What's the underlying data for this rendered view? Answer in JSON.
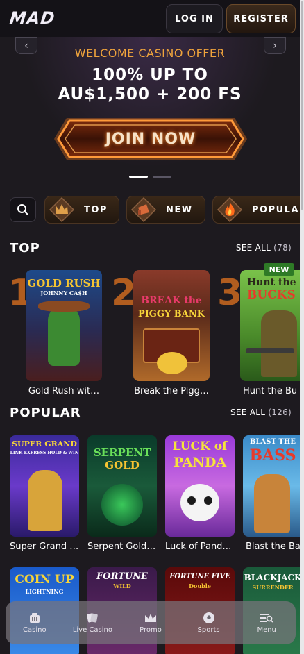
{
  "header": {
    "logo": "MAD",
    "login_label": "LOG IN",
    "register_label": "REGISTER"
  },
  "banner": {
    "offer": "WELCOME CASINO OFFER",
    "headline_line1": "100% UP TO",
    "headline_line2": "AU$1,500 + 200 FS",
    "cta_label": "JOIN NOW",
    "slide_count": 2,
    "active_slide": 1
  },
  "categories": [
    {
      "label": "TOP",
      "icon": "crown-icon"
    },
    {
      "label": "NEW",
      "icon": "megaphone-icon"
    },
    {
      "label": "POPULAR",
      "icon": "fire-icon"
    }
  ],
  "top": {
    "title": "TOP",
    "see_all_label": "SEE ALL",
    "count": "(78)",
    "items": [
      {
        "rank": "1",
        "title": "Gold Rush wit…",
        "art_line1": "GOLD RUSH",
        "art_line2": "JOHNNY CA$H"
      },
      {
        "rank": "2",
        "title": "Break the Pigg…",
        "art_line1": "BREAK the",
        "art_line2": "PIGGY BANK"
      },
      {
        "rank": "3",
        "title": "Hunt the Bu",
        "art_line1": "Hunt the",
        "art_line2": "BUCKS",
        "badge": "NEW"
      }
    ]
  },
  "popular": {
    "title": "POPULAR",
    "see_all_label": "SEE ALL",
    "count": "(126)",
    "items": [
      {
        "title": "Super Grand …",
        "art_line1": "SUPER GRAND",
        "art_line2": "LINK EXPRESS HOLD & WIN"
      },
      {
        "title": "Serpent Gold…",
        "art_line1": "SERPENT",
        "art_line2": "GOLD"
      },
      {
        "title": "Luck of Pand…",
        "art_line1": "LUCK of",
        "art_line2": "PANDA"
      },
      {
        "title": "Blast the Ba",
        "art_line1": "BLAST THE",
        "art_line2": "BASS"
      }
    ],
    "row2": [
      {
        "art_line1": "COIN UP",
        "art_line2": "LIGHTNING"
      },
      {
        "art_line1": "FORTUNE",
        "art_line2": "WILD"
      },
      {
        "art_line1": "FORTUNE FIVE",
        "art_line2": "Double"
      },
      {
        "art_line1": "BLACKJACK",
        "art_line2": "SURRENDER"
      }
    ]
  },
  "nav": [
    {
      "label": "Casino",
      "icon": "casino-icon"
    },
    {
      "label": "Live Casino",
      "icon": "cards-icon"
    },
    {
      "label": "Promo",
      "icon": "crown-icon"
    },
    {
      "label": "Sports",
      "icon": "ball-icon"
    },
    {
      "label": "Menu",
      "icon": "menu-icon"
    }
  ],
  "colors": {
    "accent": "#f0a43c",
    "cta_glow": "#ff6a1a",
    "background": "#1d1a1f"
  }
}
